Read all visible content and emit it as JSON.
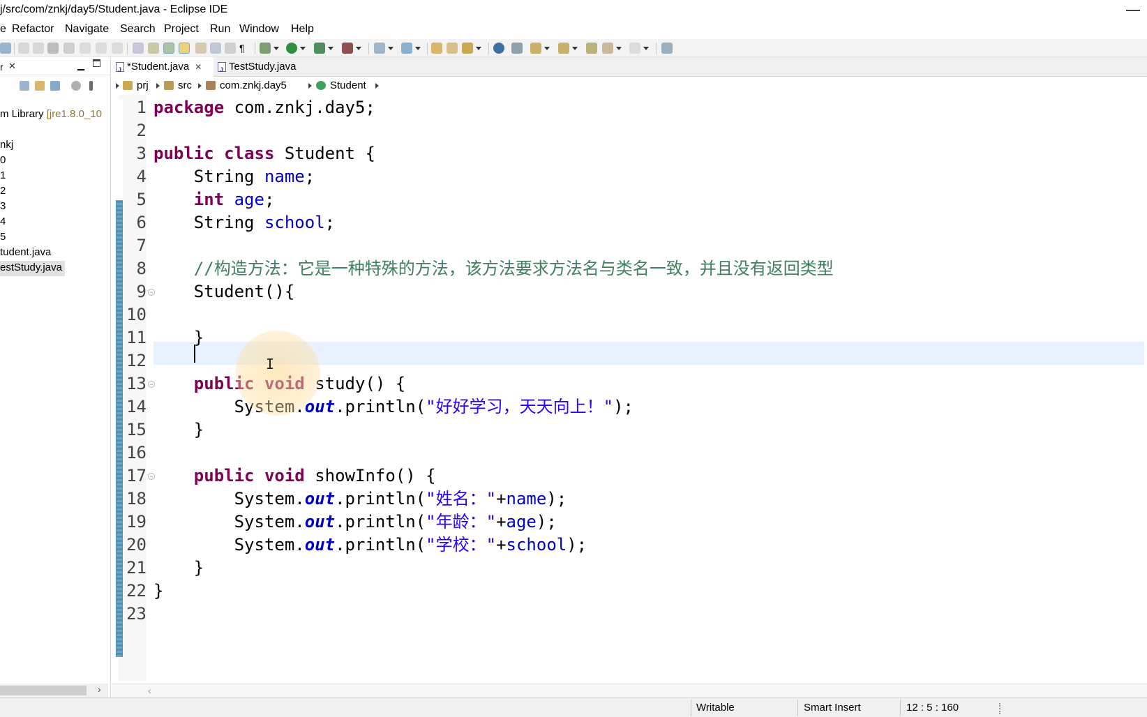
{
  "window": {
    "title": "j/src/com/znkj/day5/Student.java - Eclipse IDE"
  },
  "menubar": {
    "items": [
      "e",
      "Refactor",
      "Navigate",
      "Search",
      "Project",
      "Run",
      "Window",
      "Help"
    ]
  },
  "left_panel": {
    "tab_label": "r",
    "tree": [
      {
        "label": "m Library",
        "suffix": "[jre1.8.0_10"
      },
      {
        "label": "nkj"
      },
      {
        "label": "0"
      },
      {
        "label": "1"
      },
      {
        "label": "2"
      },
      {
        "label": "3"
      },
      {
        "label": "4"
      },
      {
        "label": "5"
      },
      {
        "label": "tudent.java"
      },
      {
        "label": "estStudy.java"
      }
    ]
  },
  "editor": {
    "tabs": [
      {
        "label": "*Student.java",
        "active": true
      },
      {
        "label": "TestStudy.java",
        "active": false
      }
    ],
    "breadcrumb": [
      "prj",
      "src",
      "com.znkj.day5",
      "Student"
    ],
    "line_numbers": [
      "1",
      "2",
      "3",
      "4",
      "5",
      "6",
      "7",
      "8",
      "9",
      "10",
      "11",
      "12",
      "13",
      "14",
      "15",
      "16",
      "17",
      "18",
      "19",
      "20",
      "21",
      "22",
      "23"
    ]
  },
  "code": {
    "l1": {
      "kw": "package",
      "rest": " com.znkj.day5;"
    },
    "l3": {
      "kw1": "public",
      "kw2": "class",
      "rest": " Student {"
    },
    "l4": {
      "type": "String",
      "field": "name",
      "end": ";"
    },
    "l5": {
      "kw": "int",
      "field": "age",
      "end": ";"
    },
    "l6": {
      "type": "String",
      "field": "school",
      "end": ";"
    },
    "l8": {
      "comment": "//构造方法：它是一种特殊的方法，该方法要求方法名与类名一致，并且没有返回类型"
    },
    "l9": {
      "text": "Student(){"
    },
    "l11": {
      "text": "}"
    },
    "l13": {
      "kw1": "public",
      "kw2": "void",
      "rest": " study() {"
    },
    "l14": {
      "pre": "System.",
      "static": "out",
      "mid": ".println(",
      "str": "\"好好学习，天天向上！\"",
      "end": ");"
    },
    "l15": {
      "text": "}"
    },
    "l17": {
      "kw1": "public",
      "kw2": "void",
      "rest": " showInfo() {"
    },
    "l18": {
      "pre": "System.",
      "static": "out",
      "mid": ".println(",
      "str": "\"姓名：\"",
      "plus": "+",
      "field": "name",
      "end": ");"
    },
    "l19": {
      "pre": "System.",
      "static": "out",
      "mid": ".println(",
      "str": "\"年龄：\"",
      "plus": "+",
      "field": "age",
      "end": ");"
    },
    "l20": {
      "pre": "System.",
      "static": "out",
      "mid": ".println(",
      "str": "\"学校：\"",
      "plus": "+",
      "field": "school",
      "end": ");"
    },
    "l21": {
      "text": "}"
    },
    "l22": {
      "text": "}"
    }
  },
  "statusbar": {
    "writable": "Writable",
    "insert_mode": "Smart Insert",
    "position": "12 : 5 : 160"
  },
  "colors": {
    "keyword": "#7f0055",
    "field": "#0000c0",
    "string": "#2a00ff",
    "comment": "#3f7f5f",
    "current_line": "#e8f2fe",
    "change_ruler": "#4f8fb0"
  }
}
